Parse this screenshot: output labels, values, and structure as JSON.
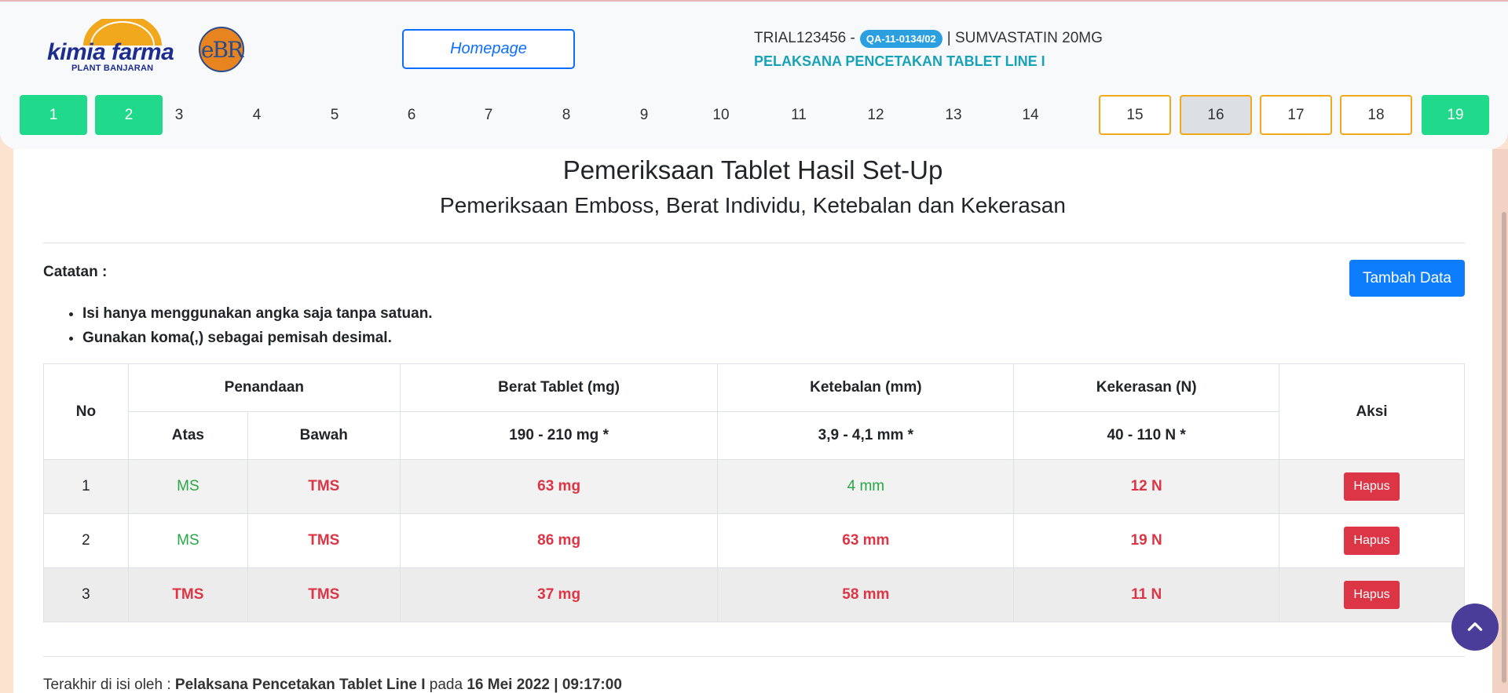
{
  "header": {
    "brand_name": "kimia farma",
    "brand_sub": "PLANT BANJARAN",
    "ebr_logo_text": "eBR",
    "homepage_label": "Homepage",
    "trial_code": "TRIAL123456 -",
    "qa_badge": "QA-11-0134/02",
    "product": "| SUMVASTATIN 20MG",
    "stage": "PELAKSANA PENCETAKAN TABLET LINE I"
  },
  "steps": [
    {
      "label": "1",
      "state": "done"
    },
    {
      "label": "2",
      "state": "done"
    },
    {
      "label": "3",
      "state": "plain"
    },
    {
      "label": "4",
      "state": "plain"
    },
    {
      "label": "5",
      "state": "plain"
    },
    {
      "label": "6",
      "state": "plain"
    },
    {
      "label": "7",
      "state": "plain"
    },
    {
      "label": "8",
      "state": "plain"
    },
    {
      "label": "9",
      "state": "plain"
    },
    {
      "label": "10",
      "state": "plain"
    },
    {
      "label": "11",
      "state": "plain"
    },
    {
      "label": "12",
      "state": "plain"
    },
    {
      "label": "13",
      "state": "plain"
    },
    {
      "label": "14",
      "state": "plain"
    },
    {
      "label": "15",
      "state": "pending"
    },
    {
      "label": "16",
      "state": "current"
    },
    {
      "label": "17",
      "state": "pending"
    },
    {
      "label": "18",
      "state": "pending"
    },
    {
      "label": "19",
      "state": "done"
    }
  ],
  "main": {
    "title": "Pemeriksaan Tablet Hasil Set-Up",
    "subtitle": "Pemeriksaan Emboss, Berat Individu, Ketebalan dan Kekerasan",
    "catatan_label": "Catatan :",
    "notes": [
      "Isi hanya menggunakan angka saja tanpa satuan.",
      "Gunakan koma(,) sebagai pemisah desimal."
    ],
    "add_button": "Tambah Data"
  },
  "table": {
    "headers": {
      "no": "No",
      "penandaan": "Penandaan",
      "atas": "Atas",
      "bawah": "Bawah",
      "berat": "Berat Tablet (mg)",
      "berat_spec": "190 - 210 mg *",
      "ketebalan": "Ketebalan (mm)",
      "ketebalan_spec": "3,9 - 4,1 mm *",
      "kekerasan": "Kekerasan (N)",
      "kekerasan_spec": "40 - 110 N *",
      "aksi": "Aksi"
    },
    "rows": [
      {
        "no": "1",
        "atas": "MS",
        "bawah": "TMS",
        "berat": "63 mg",
        "ketebalan": "4 mm",
        "kekerasan": "12 N",
        "aksi": "Hapus",
        "status": {
          "atas": "ok",
          "bawah": "bad",
          "berat": "bad",
          "ketebalan": "ok",
          "kekerasan": "bad"
        }
      },
      {
        "no": "2",
        "atas": "MS",
        "bawah": "TMS",
        "berat": "86 mg",
        "ketebalan": "63 mm",
        "kekerasan": "19 N",
        "aksi": "Hapus",
        "status": {
          "atas": "ok",
          "bawah": "bad",
          "berat": "bad",
          "ketebalan": "bad",
          "kekerasan": "bad"
        }
      },
      {
        "no": "3",
        "atas": "TMS",
        "bawah": "TMS",
        "berat": "37 mg",
        "ketebalan": "58 mm",
        "kekerasan": "11 N",
        "aksi": "Hapus",
        "status": {
          "atas": "bad",
          "bawah": "bad",
          "berat": "bad",
          "ketebalan": "bad",
          "kekerasan": "bad"
        }
      }
    ]
  },
  "footer": {
    "prefix": "Terakhir di isi oleh :",
    "user": "Pelaksana Pencetakan Tablet Line I",
    "pada": "pada",
    "datetime": "16 Mei 2022 | 09:17:00"
  },
  "colors": {
    "ok": "#28a745",
    "bad": "#dc3545",
    "done_step": "#20d98a",
    "pending_border": "#f0a81c",
    "primary": "#0d6efd"
  }
}
